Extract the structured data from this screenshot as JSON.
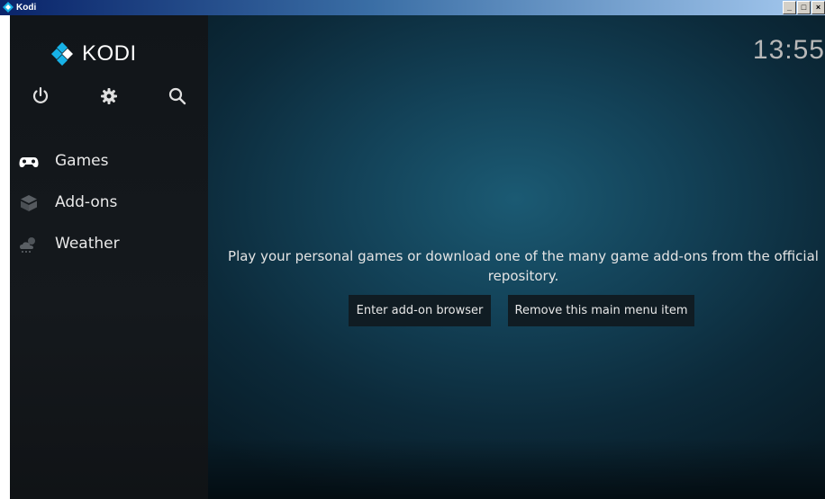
{
  "window": {
    "title": "Kodi",
    "minimize_label": "_",
    "maximize_label": "□",
    "close_label": "×"
  },
  "header": {
    "logo_text": "KODI",
    "clock": "13:55"
  },
  "top_icons": [
    "power-icon",
    "gear-icon",
    "search-icon"
  ],
  "menu": {
    "items": [
      {
        "label": "Games",
        "icon": "gamepad-icon"
      },
      {
        "label": "Add-ons",
        "icon": "addon-box-icon"
      },
      {
        "label": "Weather",
        "icon": "weather-icon"
      }
    ]
  },
  "content": {
    "message": "Play your personal games or download one of the many game add-ons from the official repository.",
    "buttons": {
      "browser": "Enter add-on browser",
      "remove": "Remove this main menu item"
    }
  },
  "colors": {
    "accent": "#17b2e7",
    "sidebar_bg": "#14181c",
    "background": "#134258",
    "button_bg": "#101c23"
  }
}
